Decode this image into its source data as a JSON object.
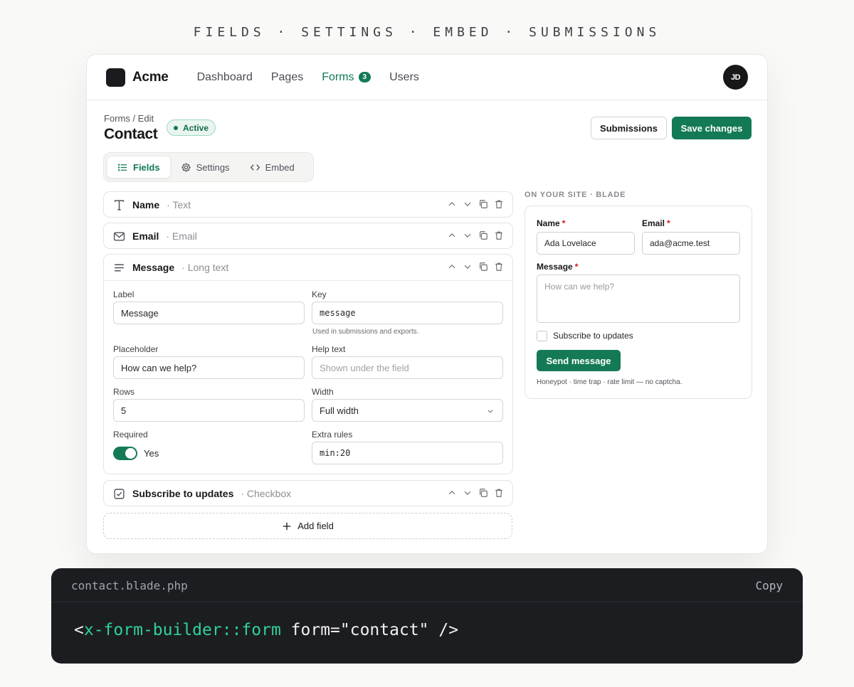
{
  "caption": "FIELDS · SETTINGS · EMBED · SUBMISSIONS",
  "app": {
    "brand": "Acme",
    "nav": [
      {
        "label": "Dashboard"
      },
      {
        "label": "Pages"
      },
      {
        "label": "Forms",
        "badge": "3",
        "active": true
      },
      {
        "label": "Users"
      }
    ],
    "avatar": "JD"
  },
  "page": {
    "breadcrumb": "Forms / Edit",
    "title": "Contact",
    "status": "Active",
    "submissions_button": "Submissions",
    "save_button": "Save changes"
  },
  "tabs": [
    {
      "label": "Fields",
      "icon": "list-icon",
      "active": true
    },
    {
      "label": "Settings",
      "icon": "gear-icon"
    },
    {
      "label": "Embed",
      "icon": "code-icon"
    }
  ],
  "fields": [
    {
      "name": "Name",
      "type": "· Text",
      "icon": "text-icon"
    },
    {
      "name": "Email",
      "type": "· Email",
      "icon": "mail-icon"
    },
    {
      "name": "Message",
      "type": "· Long text",
      "icon": "paragraph-icon"
    },
    {
      "name": "Subscribe to updates",
      "type": "· Checkbox",
      "icon": "checkbox-icon"
    }
  ],
  "editor": {
    "label_label": "Label",
    "label_value": "Message",
    "key_label": "Key",
    "key_value": "message",
    "key_hint": "Used in submissions and exports.",
    "placeholder_label": "Placeholder",
    "placeholder_value": "How can we help?",
    "help_label": "Help text",
    "help_placeholder": "Shown under the field",
    "rows_label": "Rows",
    "rows_value": "5",
    "width_label": "Width",
    "width_value": "Full width",
    "required_label": "Required",
    "required_value": "Yes",
    "rules_label": "Extra rules",
    "rules_value": "min:20"
  },
  "add_field": "Add field",
  "preview": {
    "title": "ON YOUR SITE · BLADE",
    "name_label": "Name",
    "name_value": "Ada Lovelace",
    "email_label": "Email",
    "email_value": "ada@acme.test",
    "message_label": "Message",
    "message_placeholder": "How can we help?",
    "subscribe_label": "Subscribe to updates",
    "send_button": "Send message",
    "footnote": "Honeypot · time trap · rate limit — no captcha.",
    "required_mark": "*"
  },
  "code": {
    "filename": "contact.blade.php",
    "copy": "Copy",
    "lt": "<",
    "tag": "x-form-builder::form",
    "rest": " form=\"contact\" />"
  }
}
